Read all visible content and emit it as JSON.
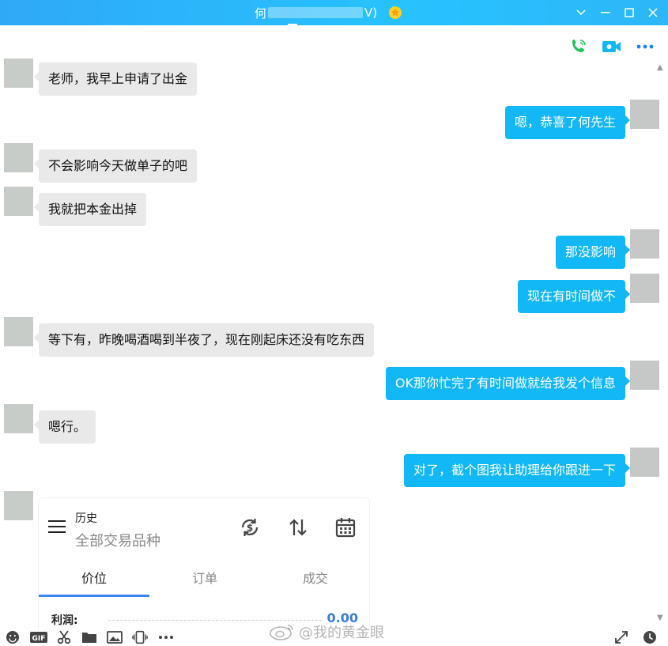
{
  "window": {
    "title_name": "何",
    "title_suffix": "V)",
    "controls": [
      "minimize",
      "restore",
      "maximize",
      "close"
    ]
  },
  "toolbar_top": {
    "icons": [
      "phone-call-icon",
      "video-call-icon",
      "more-icon"
    ]
  },
  "messages": [
    {
      "side": "in",
      "text": "老师，我早上申请了出金"
    },
    {
      "side": "out",
      "text": "嗯，恭喜了何先生"
    },
    {
      "side": "in",
      "text": "不会影响今天做单子的吧"
    },
    {
      "side": "in",
      "text": "我就把本金出掉"
    },
    {
      "side": "out",
      "text": "那没影响"
    },
    {
      "side": "out",
      "text": "现在有时间做不"
    },
    {
      "side": "in",
      "text": "等下有，昨晚喝酒喝到半夜了，现在刚起床还没有吃东西"
    },
    {
      "side": "out",
      "text": "OK那你忙完了有时间做就给我发个信息"
    },
    {
      "side": "in",
      "text": "嗯行。"
    },
    {
      "side": "out",
      "text": "对了，截个图我让助理给你跟进一下"
    }
  ],
  "screenshot_card": {
    "title": "历史",
    "subtitle": "全部交易品种",
    "tabs": [
      "价位",
      "订单",
      "成交"
    ],
    "active_tab": "价位",
    "profit_label": "利润:",
    "profit_value": "0.00",
    "icons": [
      "menu-icon",
      "currency-exchange-icon",
      "sort-icon",
      "calendar-icon"
    ]
  },
  "watermark": "@我的黄金眼",
  "colors": {
    "titlebar": "#27c2ff",
    "bubble_out": "#12b7f5",
    "bubble_in": "#e9e9e9",
    "accent_blue": "#3b7be6"
  }
}
